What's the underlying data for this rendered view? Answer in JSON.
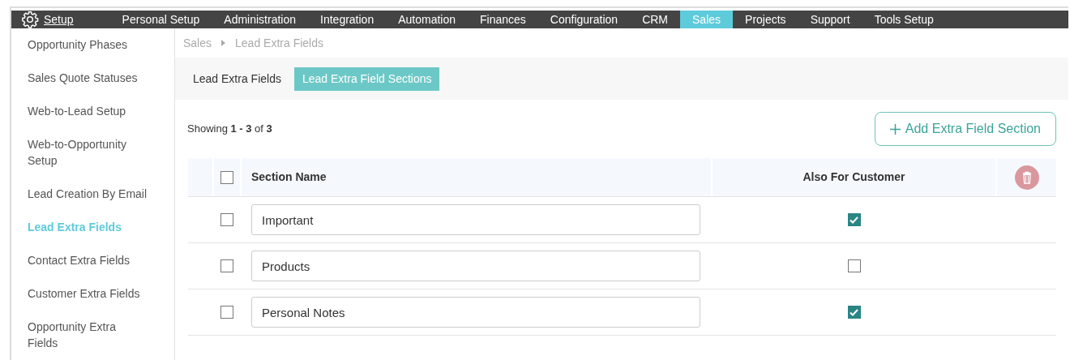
{
  "topnav": {
    "brand": "Setup",
    "items": [
      {
        "label": "Personal Setup",
        "selected": false
      },
      {
        "label": "Administration",
        "selected": false
      },
      {
        "label": "Integration",
        "selected": false
      },
      {
        "label": "Automation",
        "selected": false
      },
      {
        "label": "Finances",
        "selected": false
      },
      {
        "label": "Configuration",
        "selected": false
      },
      {
        "label": "CRM",
        "selected": false
      },
      {
        "label": "Sales",
        "selected": true
      },
      {
        "label": "Projects",
        "selected": false
      },
      {
        "label": "Support",
        "selected": false
      },
      {
        "label": "Tools Setup",
        "selected": false
      }
    ]
  },
  "sidebar": {
    "items": [
      {
        "label": "Opportunity Phases",
        "selected": false
      },
      {
        "label": "Sales Quote Statuses",
        "selected": false
      },
      {
        "label": "Web-to-Lead Setup",
        "selected": false
      },
      {
        "label": "Web-to-Opportunity Setup",
        "selected": false
      },
      {
        "label": "Lead Creation By Email",
        "selected": false
      },
      {
        "label": "Lead Extra Fields",
        "selected": true
      },
      {
        "label": "Contact Extra Fields",
        "selected": false
      },
      {
        "label": "Customer Extra Fields",
        "selected": false
      },
      {
        "label": "Opportunity Extra Fields",
        "selected": false
      }
    ]
  },
  "breadcrumb": [
    "Sales",
    "Lead Extra Fields"
  ],
  "tabs": [
    {
      "label": "Lead Extra Fields",
      "selected": false
    },
    {
      "label": "Lead Extra Field Sections",
      "selected": true
    }
  ],
  "showing": "Showing **1 - 3** of **3**",
  "add_button": "Add Extra Field Section",
  "table": {
    "select_all_checked": false,
    "columns": [
      "Section Name",
      "Also For Customer"
    ],
    "rows": [
      {
        "checked": false,
        "section_name": "Important",
        "also_for_customer": true
      },
      {
        "checked": false,
        "section_name": "Products",
        "also_for_customer": false
      },
      {
        "checked": false,
        "section_name": "Personal Notes",
        "also_for_customer": true
      }
    ]
  }
}
